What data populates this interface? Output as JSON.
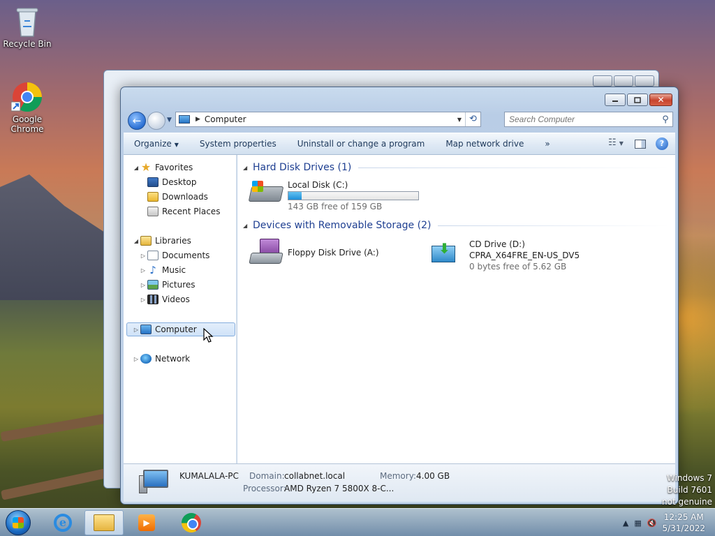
{
  "desktop": {
    "icons": [
      {
        "label": "Recycle Bin",
        "icon": "recycle-bin-icon"
      },
      {
        "label": "Google Chrome",
        "icon": "chrome-icon"
      }
    ],
    "watermark": [
      "Windows 7",
      "Build 7601",
      "not genuine"
    ]
  },
  "window": {
    "address": {
      "location": "Computer"
    },
    "search": {
      "placeholder": "Search Computer"
    },
    "toolbar": {
      "organize": "Organize",
      "system_properties": "System properties",
      "uninstall": "Uninstall or change a program",
      "map_drive": "Map network drive",
      "more": "»"
    },
    "nav_pane": {
      "favorites": {
        "label": "Favorites",
        "items": [
          "Desktop",
          "Downloads",
          "Recent Places"
        ]
      },
      "libraries": {
        "label": "Libraries",
        "items": [
          "Documents",
          "Music",
          "Pictures",
          "Videos"
        ]
      },
      "computer": "Computer",
      "network": "Network"
    },
    "groups": {
      "hard_disks": {
        "title": "Hard Disk Drives (1)",
        "drives": [
          {
            "name": "Local Disk (C:)",
            "free_text": "143 GB free of 159 GB",
            "used_fraction": 0.1
          }
        ]
      },
      "removable": {
        "title": "Devices with Removable Storage (2)",
        "floppy": {
          "name": "Floppy Disk Drive (A:)"
        },
        "cd": {
          "name": "CD Drive (D:)",
          "label": "CPRA_X64FRE_EN-US_DV5",
          "free_text": "0 bytes free of 5.62 GB"
        }
      }
    },
    "details": {
      "pc_name": "KUMALALA-PC",
      "domain_label": "Domain:",
      "domain_value": "collabnet.local",
      "memory_label": "Memory:",
      "memory_value": "4.00 GB",
      "processor_label": "Processor:",
      "processor_value": "AMD Ryzen 7 5800X 8-C..."
    }
  },
  "taskbar": {
    "time": "12:25 AM",
    "date": "5/31/2022"
  },
  "colors": {
    "accent": "#1e3f91",
    "usage_fill": "#1e8fd8",
    "selection": "#cfe2f8"
  }
}
